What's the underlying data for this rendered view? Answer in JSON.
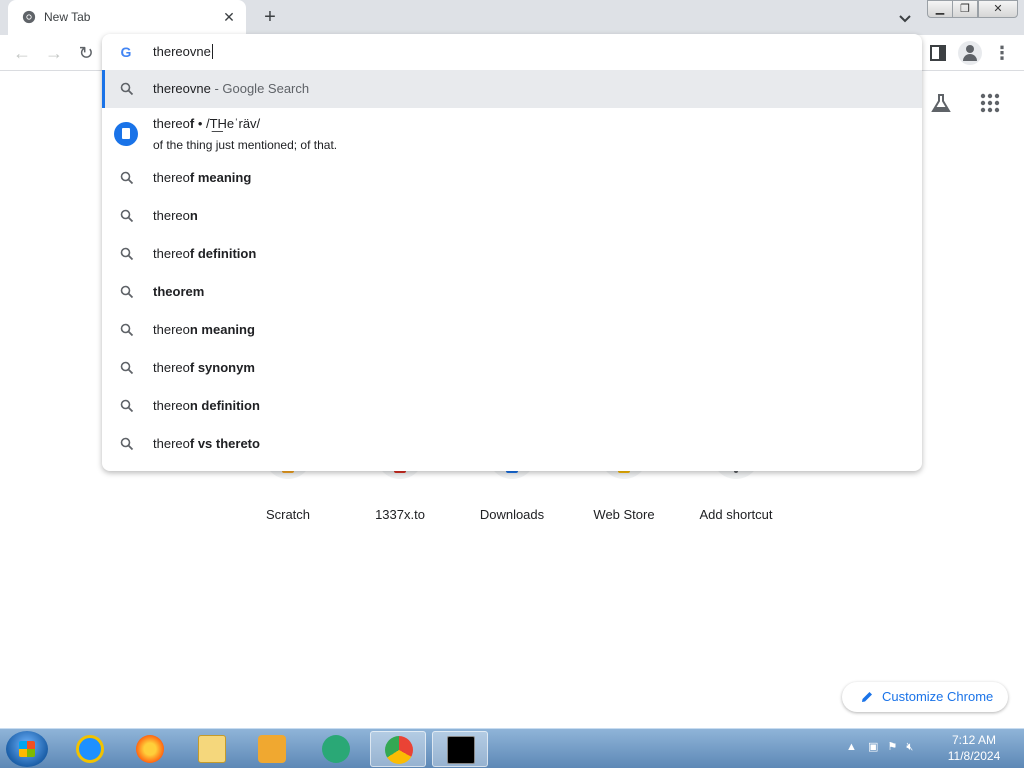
{
  "tab": {
    "title": "New Tab",
    "close": "✕"
  },
  "window_controls": {
    "minimize": "▁",
    "maximize": "❐",
    "close": "✕"
  },
  "omnibox": {
    "query": "thereovne"
  },
  "suggestions": [
    {
      "type": "search",
      "prefix": "thereovne",
      "bold": "",
      "extra": " - Google Search",
      "selected": true
    },
    {
      "type": "dictionary",
      "prefix": "thereo",
      "bold": "f",
      "pronunciation": " • /T͟Heˈräv/",
      "definition": "of the thing just mentioned; of that."
    },
    {
      "type": "search",
      "prefix": "thereo",
      "bold": "f meaning"
    },
    {
      "type": "search",
      "prefix": "thereo",
      "bold": "n"
    },
    {
      "type": "search",
      "prefix": "thereo",
      "bold": "f definition"
    },
    {
      "type": "search",
      "prefix": "",
      "bold": "theorem"
    },
    {
      "type": "search",
      "prefix": "thereo",
      "bold": "n meaning"
    },
    {
      "type": "search",
      "prefix": "thereo",
      "bold": "f synonym"
    },
    {
      "type": "search",
      "prefix": "thereo",
      "bold": "n definition"
    },
    {
      "type": "search",
      "prefix": "thereo",
      "bold": "f vs thereto"
    }
  ],
  "shortcuts": [
    {
      "label": "Scratch",
      "color": "#f6a623"
    },
    {
      "label": "1337x.to",
      "color": "#d93025"
    },
    {
      "label": "Downloads",
      "color": "#1a73e8"
    },
    {
      "label": "Web Store",
      "color": "#fbbc04"
    },
    {
      "label": "Add shortcut",
      "color": "#5f6368"
    }
  ],
  "customize": {
    "label": "Customize Chrome"
  },
  "clock": {
    "time": "7:12 AM",
    "date": "11/8/2024"
  }
}
